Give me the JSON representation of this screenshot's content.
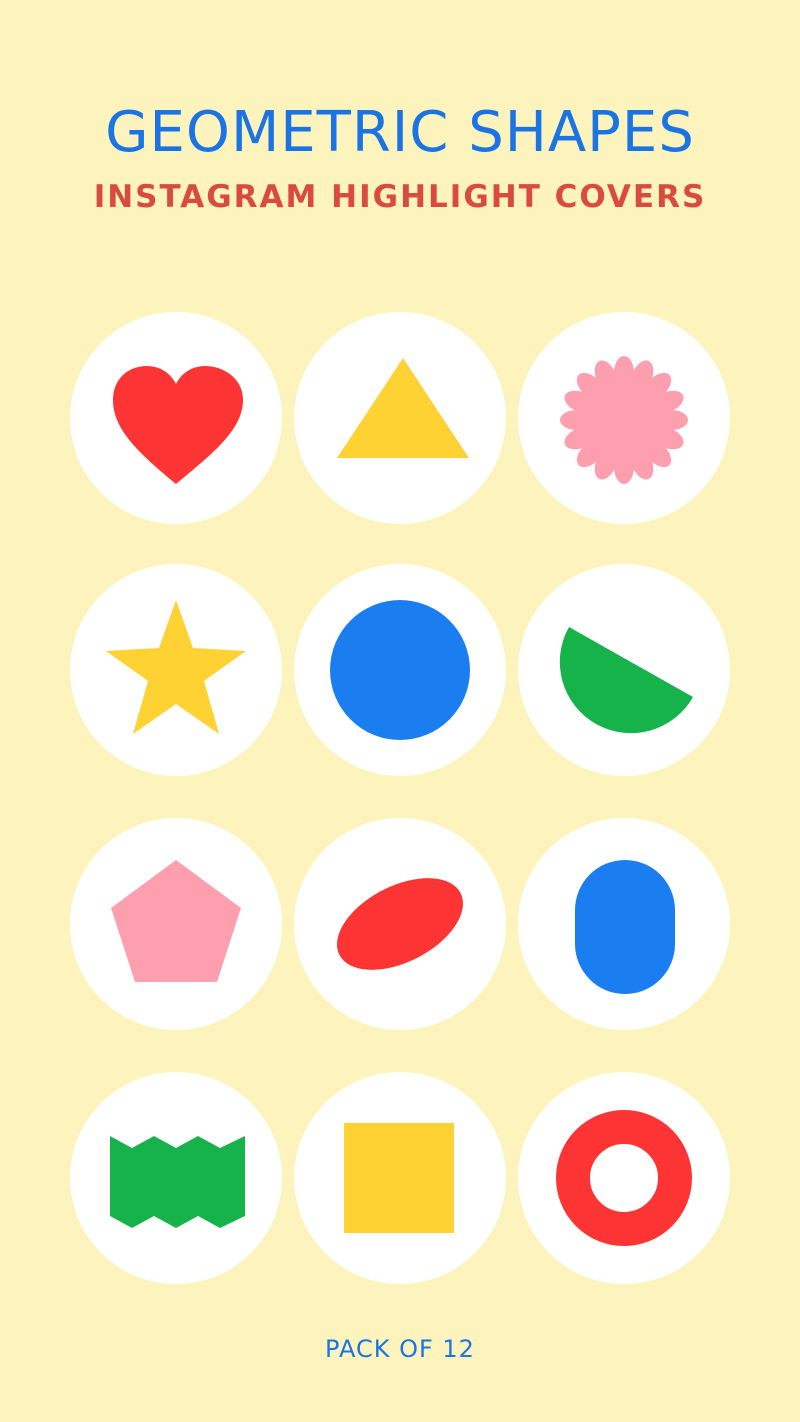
{
  "header": {
    "title": "GEOMETRIC SHAPES",
    "subtitle": "INSTAGRAM HIGHLIGHT COVERS"
  },
  "footer": {
    "text": "PACK OF 12"
  },
  "colors": {
    "background": "#fdf4bd",
    "blue": "#1b74e4",
    "red": "#fc3534",
    "yellow": "#ffd233",
    "pink": "#fe9fb0",
    "green": "#16b24a",
    "title_blue": "#1b74e4",
    "subtitle_red": "#d94a3f"
  },
  "covers": [
    {
      "icon": "heart-icon",
      "color": "#fc3534"
    },
    {
      "icon": "triangle-icon",
      "color": "#ffd233"
    },
    {
      "icon": "flower-icon",
      "color": "#fe9fb0"
    },
    {
      "icon": "star-icon",
      "color": "#ffd233"
    },
    {
      "icon": "circle-icon",
      "color": "#1b7ef0"
    },
    {
      "icon": "half-circle-icon",
      "color": "#16b24a"
    },
    {
      "icon": "pentagon-icon",
      "color": "#fe9fb0"
    },
    {
      "icon": "ellipse-icon",
      "color": "#fc3534"
    },
    {
      "icon": "stadium-icon",
      "color": "#1b7ef0"
    },
    {
      "icon": "zigzag-banner-icon",
      "color": "#16b24a"
    },
    {
      "icon": "square-icon",
      "color": "#ffd233"
    },
    {
      "icon": "ring-icon",
      "color": "#fc3534"
    }
  ]
}
